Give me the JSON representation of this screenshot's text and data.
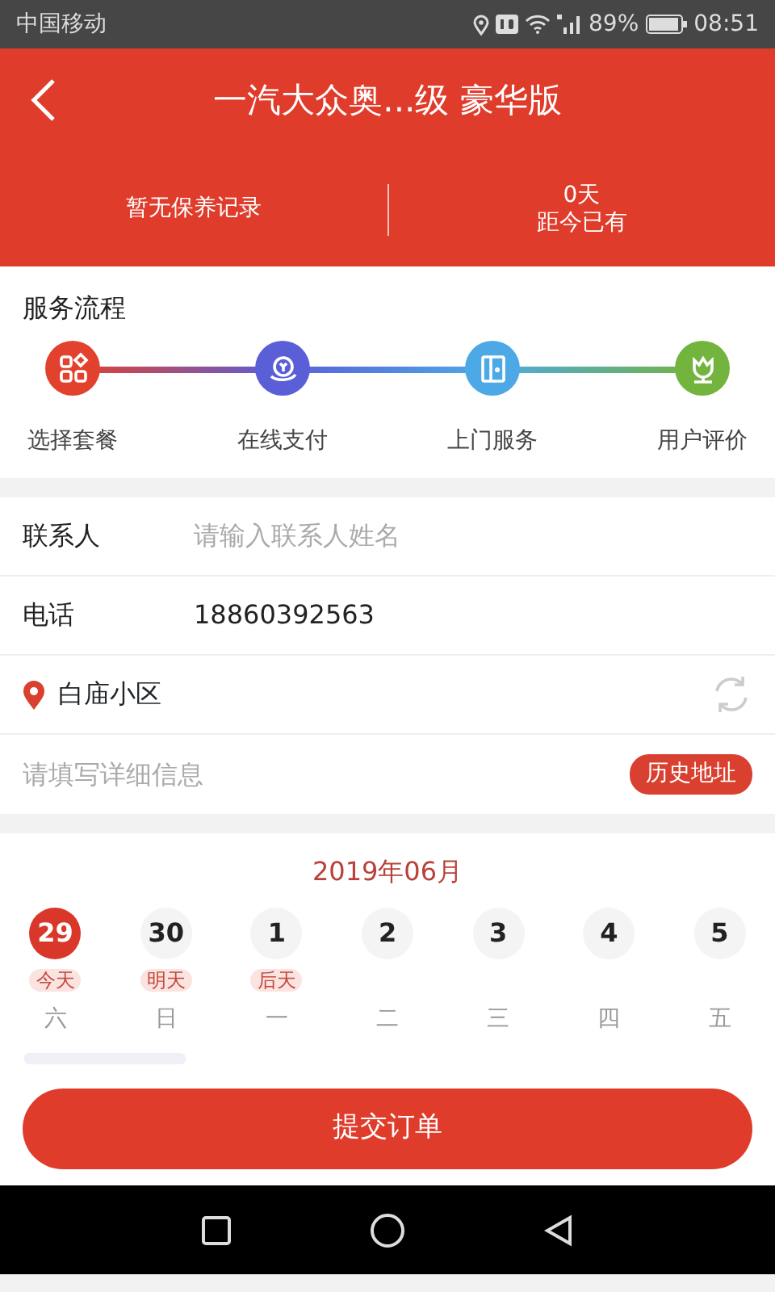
{
  "status_bar": {
    "carrier": "中国移动",
    "battery": "89%",
    "time": "08:51"
  },
  "header": {
    "title": "一汽大众奥...级 豪华版",
    "stats": [
      {
        "value": "暂无保养记录"
      },
      {
        "value": "0天",
        "label": "距今已有"
      }
    ]
  },
  "service_flow": {
    "title": "服务流程",
    "steps": [
      {
        "label": "选择套餐",
        "color": "#e2412e"
      },
      {
        "label": "在线支付",
        "color": "#5a5fd8"
      },
      {
        "label": "上门服务",
        "color": "#4da9e6"
      },
      {
        "label": "用户评价",
        "color": "#72b43e"
      }
    ]
  },
  "contact": {
    "label": "联系人",
    "placeholder": "请输入联系人姓名"
  },
  "phone": {
    "label": "电话",
    "value": "18860392563"
  },
  "address": {
    "name": "白庙小区",
    "placeholder": "请填写详细信息",
    "history_button": "历史地址"
  },
  "calendar": {
    "month": "2019年06月",
    "days": [
      {
        "date": "29",
        "tag": "今天",
        "weekday": "六",
        "selected": true
      },
      {
        "date": "30",
        "tag": "明天",
        "weekday": "日",
        "selected": false
      },
      {
        "date": "1",
        "tag": "后天",
        "weekday": "一",
        "selected": false
      },
      {
        "date": "2",
        "weekday": "二",
        "selected": false
      },
      {
        "date": "3",
        "weekday": "三",
        "selected": false
      },
      {
        "date": "4",
        "weekday": "四",
        "selected": false
      },
      {
        "date": "5",
        "weekday": "五",
        "selected": false
      }
    ]
  },
  "submit_button": "提交订单"
}
